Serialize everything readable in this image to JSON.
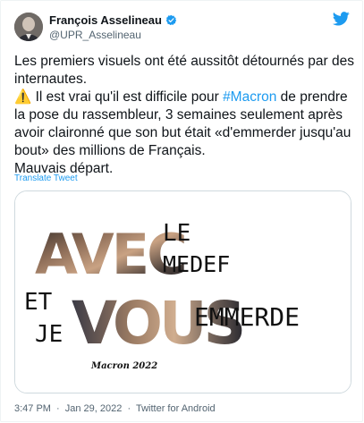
{
  "author": {
    "name": "François Asselineau",
    "handle": "@UPR_Asselineau",
    "verified_icon": "verified-badge-icon"
  },
  "tweet": {
    "line1": "Les premiers visuels ont été aussitôt détournés par des internautes.",
    "warning_icon": "⚠️",
    "line2_before": " Il est vrai qu'il est difficile pour ",
    "hashtag": "#Macron",
    "line2_after": " de prendre la pose du rassembleur, 3 semaines seulement après avoir claironné que son but était «d'emmerder jusqu'au bout» des millions de Français.",
    "line3": "Mauvais départ.",
    "translate_label": "Translate Tweet"
  },
  "media": {
    "poster_words": {
      "avec": "AVEC",
      "le": "LE",
      "medef": "MEDEF",
      "et": "ET",
      "je": "JE",
      "vous": "VOUS",
      "emmerde": "EMMERDE",
      "signature": "Macron 2022"
    }
  },
  "meta": {
    "time": "3:47 PM",
    "separator": "·",
    "date": "Jan 29, 2022",
    "source": "Twitter for Android"
  },
  "colors": {
    "accent": "#1d9bf0",
    "text": "#0f1419",
    "secondary": "#536471",
    "border": "#cfd9de"
  }
}
